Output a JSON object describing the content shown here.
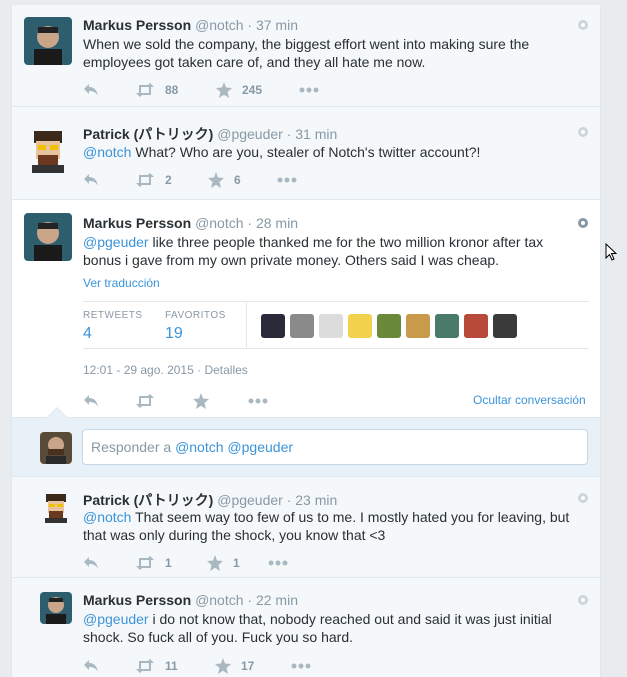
{
  "tweets": [
    {
      "fullname": "Markus Persson",
      "username": "@notch",
      "time": "· 37 min",
      "text_parts": [
        "When we sold the company, the biggest effort went into making sure the",
        "employees got taken care of, and they all hate me now."
      ],
      "retweets": "88",
      "favorites": "245"
    },
    {
      "fullname": "Patrick (パトリック)",
      "username": "@pgeuder",
      "time": "· 31 min",
      "mention": "@notch",
      "text": " What? Who are you, stealer of Notch's twitter account?!",
      "retweets": "2",
      "favorites": "6"
    },
    {
      "fullname": "Markus Persson",
      "username": "@notch",
      "time": "· 28 min",
      "mention": "@pgeuder",
      "text_line1": " like three people thanked me for the two million kronor after tax",
      "text_line2": "bonus i gave from my own private money. Others said I was cheap.",
      "translate": "Ver traducción",
      "retweets_label": "RETWEETS",
      "retweets_value": "4",
      "favorites_label": "FAVORITOS",
      "favorites_value": "19",
      "timestamp": "12:01 - 29 ago. 2015",
      "details": "Detalles",
      "hide_conversation": "Ocultar conversación"
    },
    {
      "fullname": "Patrick (パトリック)",
      "username": "@pgeuder",
      "time": "· 23 min",
      "mention": "@notch",
      "text_line1": " That seem way too few of us to me. I mostly hated you for leaving, but",
      "text_line2": "that was only during the shock, you know that <3",
      "retweets": "1",
      "favorites": "1"
    },
    {
      "fullname": "Markus Persson",
      "username": "@notch",
      "time": "· 22 min",
      "mention": "@pgeuder",
      "text_line1": " i do not know that, nobody reached out and said it was just initial",
      "text_line2": "shock. So fuck all of you. Fuck you so hard.",
      "retweets": "11",
      "favorites": "17"
    }
  ],
  "reply": {
    "prefix": "Responder a ",
    "mention1": "@notch",
    "mention2": "@pgeuder"
  },
  "icons": {
    "reply": "reply-icon",
    "retweet": "retweet-icon",
    "favorite": "star-icon",
    "more": "more-icon",
    "gear": "dropdown-icon"
  },
  "colors": {
    "link": "#3b94d9",
    "muted": "#8899a6",
    "action": "#aab8c2"
  }
}
